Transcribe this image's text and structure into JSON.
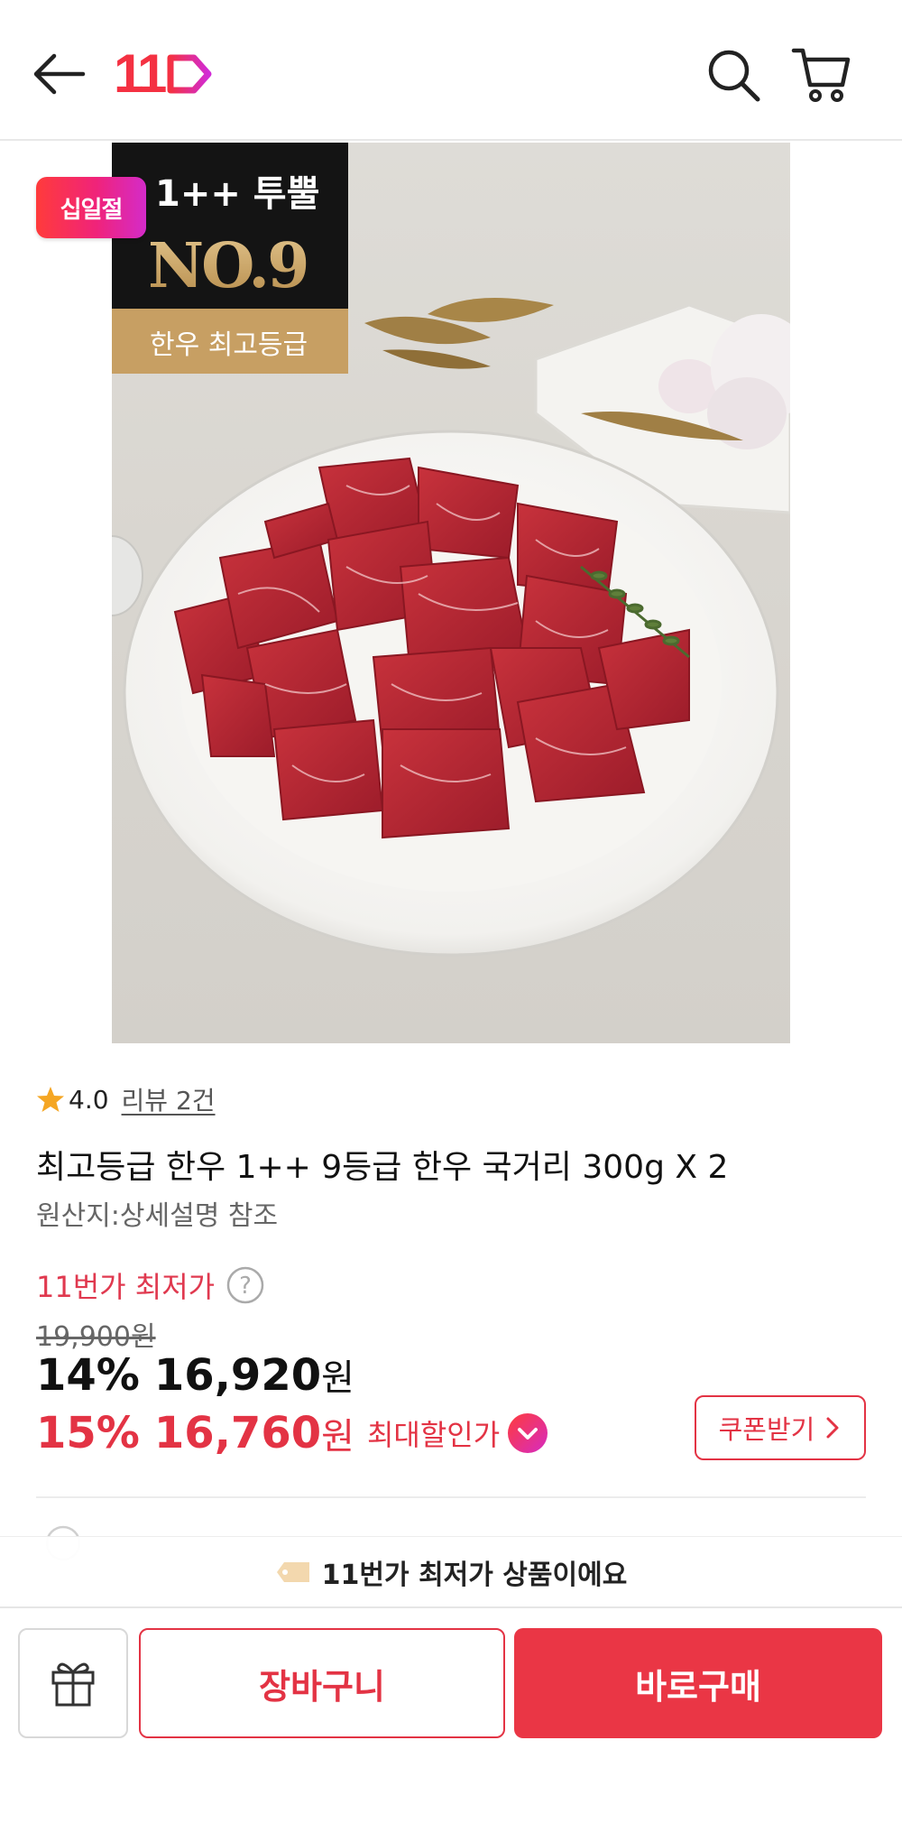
{
  "header": {
    "back_icon": "arrow-left-icon",
    "logo_text": "11",
    "search_icon": "search-icon",
    "cart_icon": "cart-icon",
    "brand_color": "#f43142"
  },
  "product_image": {
    "promo_badge": "십일절",
    "grade_line1": "1++ 투뿔",
    "grade_line2": "NO.9",
    "grade_line3": "한우 최고등급"
  },
  "rating": {
    "value": "4.0",
    "reviews": "리뷰 2건"
  },
  "product": {
    "title": "최고등급 한우 1++ 9등급 한우 국거리 300g X 2",
    "origin": "원산지:상세설명 참조"
  },
  "price": {
    "lowest_label": "11번가 최저가",
    "original": "19,900원",
    "discount1_pct": "14%",
    "discount1_amount": "16,920",
    "currency": "원",
    "discount2_pct": "15%",
    "discount2_amount": "16,760",
    "max_discount_label": "최대할인가",
    "accent_color": "#e33344"
  },
  "coupon": {
    "label": "쿠폰받기"
  },
  "toast": {
    "text": "11번가 최저가 상품이에요"
  },
  "bottom_bar": {
    "gift_icon": "gift-icon",
    "cart_label": "장바구니",
    "buy_label": "바로구매"
  }
}
